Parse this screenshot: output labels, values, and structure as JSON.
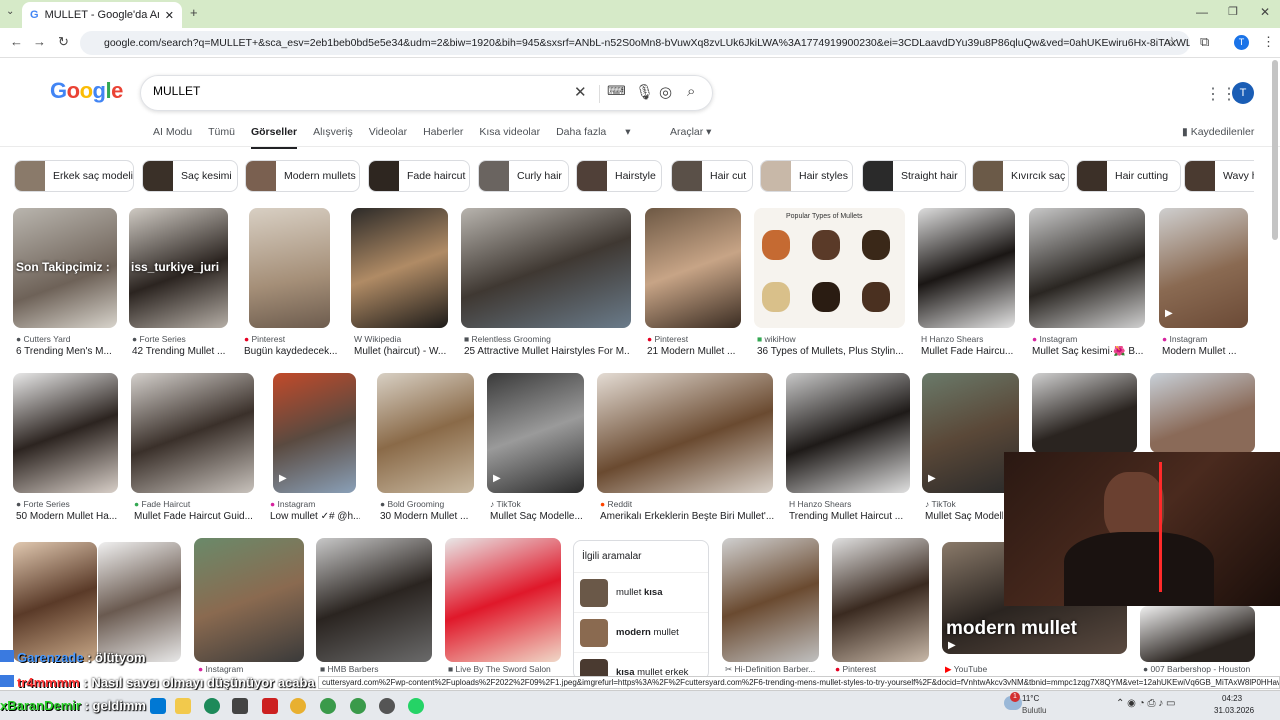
{
  "browser": {
    "tab_title": "MULLET - Google'da Ara",
    "url": "google.com/search?q=MULLET+&sca_esv=2eb1beb0bd5e5e34&udm=2&biw=1920&bih=945&sxsrf=ANbL-n52S0oMn8-bVuwXq8zvLUk6JkiLWA%3A1774919900230&ei=3CDLaavdDYu39u8P86qluQw&ved=0ahUKEwiru6Hx-8iTAxWLm_0HHXNVKccQ4dUD...",
    "profile_initial": "T"
  },
  "google": {
    "logo": "Google",
    "query": "MULLET",
    "tabs": [
      "AI Modu",
      "Tümü",
      "Görseller",
      "Alışveriş",
      "Videolar",
      "Haberler",
      "Kısa videolar",
      "Daha fazla"
    ],
    "active_tab": "Görseller",
    "tools": "Araçlar",
    "saved": "Kaydedilenler"
  },
  "chips": [
    "Erkek saç modeli",
    "Saç kesimi",
    "Modern mullets",
    "Fade haircut",
    "Curly hair",
    "Hairstyle",
    "Hair cut",
    "Hair styles",
    "Straight hair",
    "Kıvırcık saç",
    "Hair cutting",
    "Wavy h"
  ],
  "row1": [
    {
      "source": "Cutters Yard",
      "caption": "6 Trending Men's M..."
    },
    {
      "source": "Forte Series",
      "caption": "42 Trending Mullet ..."
    },
    {
      "source": "Pinterest",
      "caption": "Bugün kaydedecek..."
    },
    {
      "source": "Wikipedia",
      "caption": "Mullet (haircut) - W..."
    },
    {
      "source": "Relentless Grooming",
      "caption": "25 Attractive Mullet Hairstyles For M..."
    },
    {
      "source": "Pinterest",
      "caption": "21 Modern Mullet ..."
    },
    {
      "source": "wikiHow",
      "caption": "36 Types of Mullets, Plus Stylin..."
    },
    {
      "source": "Hanzo Shears",
      "caption": "Mullet Fade Haircu..."
    },
    {
      "source": "Instagram",
      "caption": "Mullet Saç kesimi·🌺 B..."
    },
    {
      "source": "Instagram",
      "caption": "Modern Mullet ..."
    }
  ],
  "row2": [
    {
      "source": "Forte Series",
      "caption": "50 Modern Mullet Ha..."
    },
    {
      "source": "Fade Haircut",
      "caption": "Mullet Fade Haircut Guid..."
    },
    {
      "source": "Instagram",
      "caption": "Low mullet ✓# @h..."
    },
    {
      "source": "Bold Grooming",
      "caption": "30 Modern Mullet ..."
    },
    {
      "source": "TikTok",
      "caption": "Mullet Saç Modelle..."
    },
    {
      "source": "Reddit",
      "caption": "Amerikalı Erkeklerin Beşte Biri Mullet'..."
    },
    {
      "source": "Hanzo Shears",
      "caption": "Trending Mullet Haircut ..."
    },
    {
      "source": "TikTok",
      "caption": "Mullet Saç Modelle..."
    }
  ],
  "row3_sources": [
    "Instagram",
    "HMB Barbers",
    "Live By The Sword Salon",
    "Hi-Definition Barber...",
    "Pinterest",
    "YouTube",
    "007 Barbershop - Houston"
  ],
  "image_overlays": {
    "text1": "Son Takipçimiz :",
    "text2": "iss_turkiye_juri",
    "wikihow_title": "Popular Types of Mullets",
    "modern_mullet": "modern mullet"
  },
  "related": {
    "title": "İlgili aramalar",
    "items": [
      {
        "pre": "mullet ",
        "bold": "kısa",
        "post": ""
      },
      {
        "pre": "",
        "bold": "modern",
        "post": " mullet"
      },
      {
        "pre": "",
        "bold": "kısa",
        "post": " mullet erkek"
      }
    ]
  },
  "status_url": "cuttersyard.com%2Fwp-content%2Fuploads%2F2022%2F09%2F1.jpeg&imgrefurl=https%3A%2F%2Fcuttersyard.com%2F6-trending-mens-mullet-styles-to-try-yourself%2F&docid=fVnhtwAkcv3vNM&tbnid=mmpc1zqg7X8QYM&vet=12ahUKEwiVq6GB_MiTAxW8lP0HHavyGxoQnPA...",
  "chat": [
    {
      "user": "Garenzade",
      "msg": ": ölütyom",
      "color": "#4a9aff"
    },
    {
      "user": "tr4mmmm",
      "msg": ": Nasıl savcı olmayı düşünüyor acaba",
      "color": "#ff3030"
    },
    {
      "user": "xBaranDemir",
      "msg": ": geldimm",
      "color": "#2ad02a"
    }
  ],
  "taskbar": {
    "weather_temp": "11°C",
    "weather_text": "Bulutlu",
    "time": "04:23",
    "date": "31.03.2026",
    "badge": "1"
  }
}
